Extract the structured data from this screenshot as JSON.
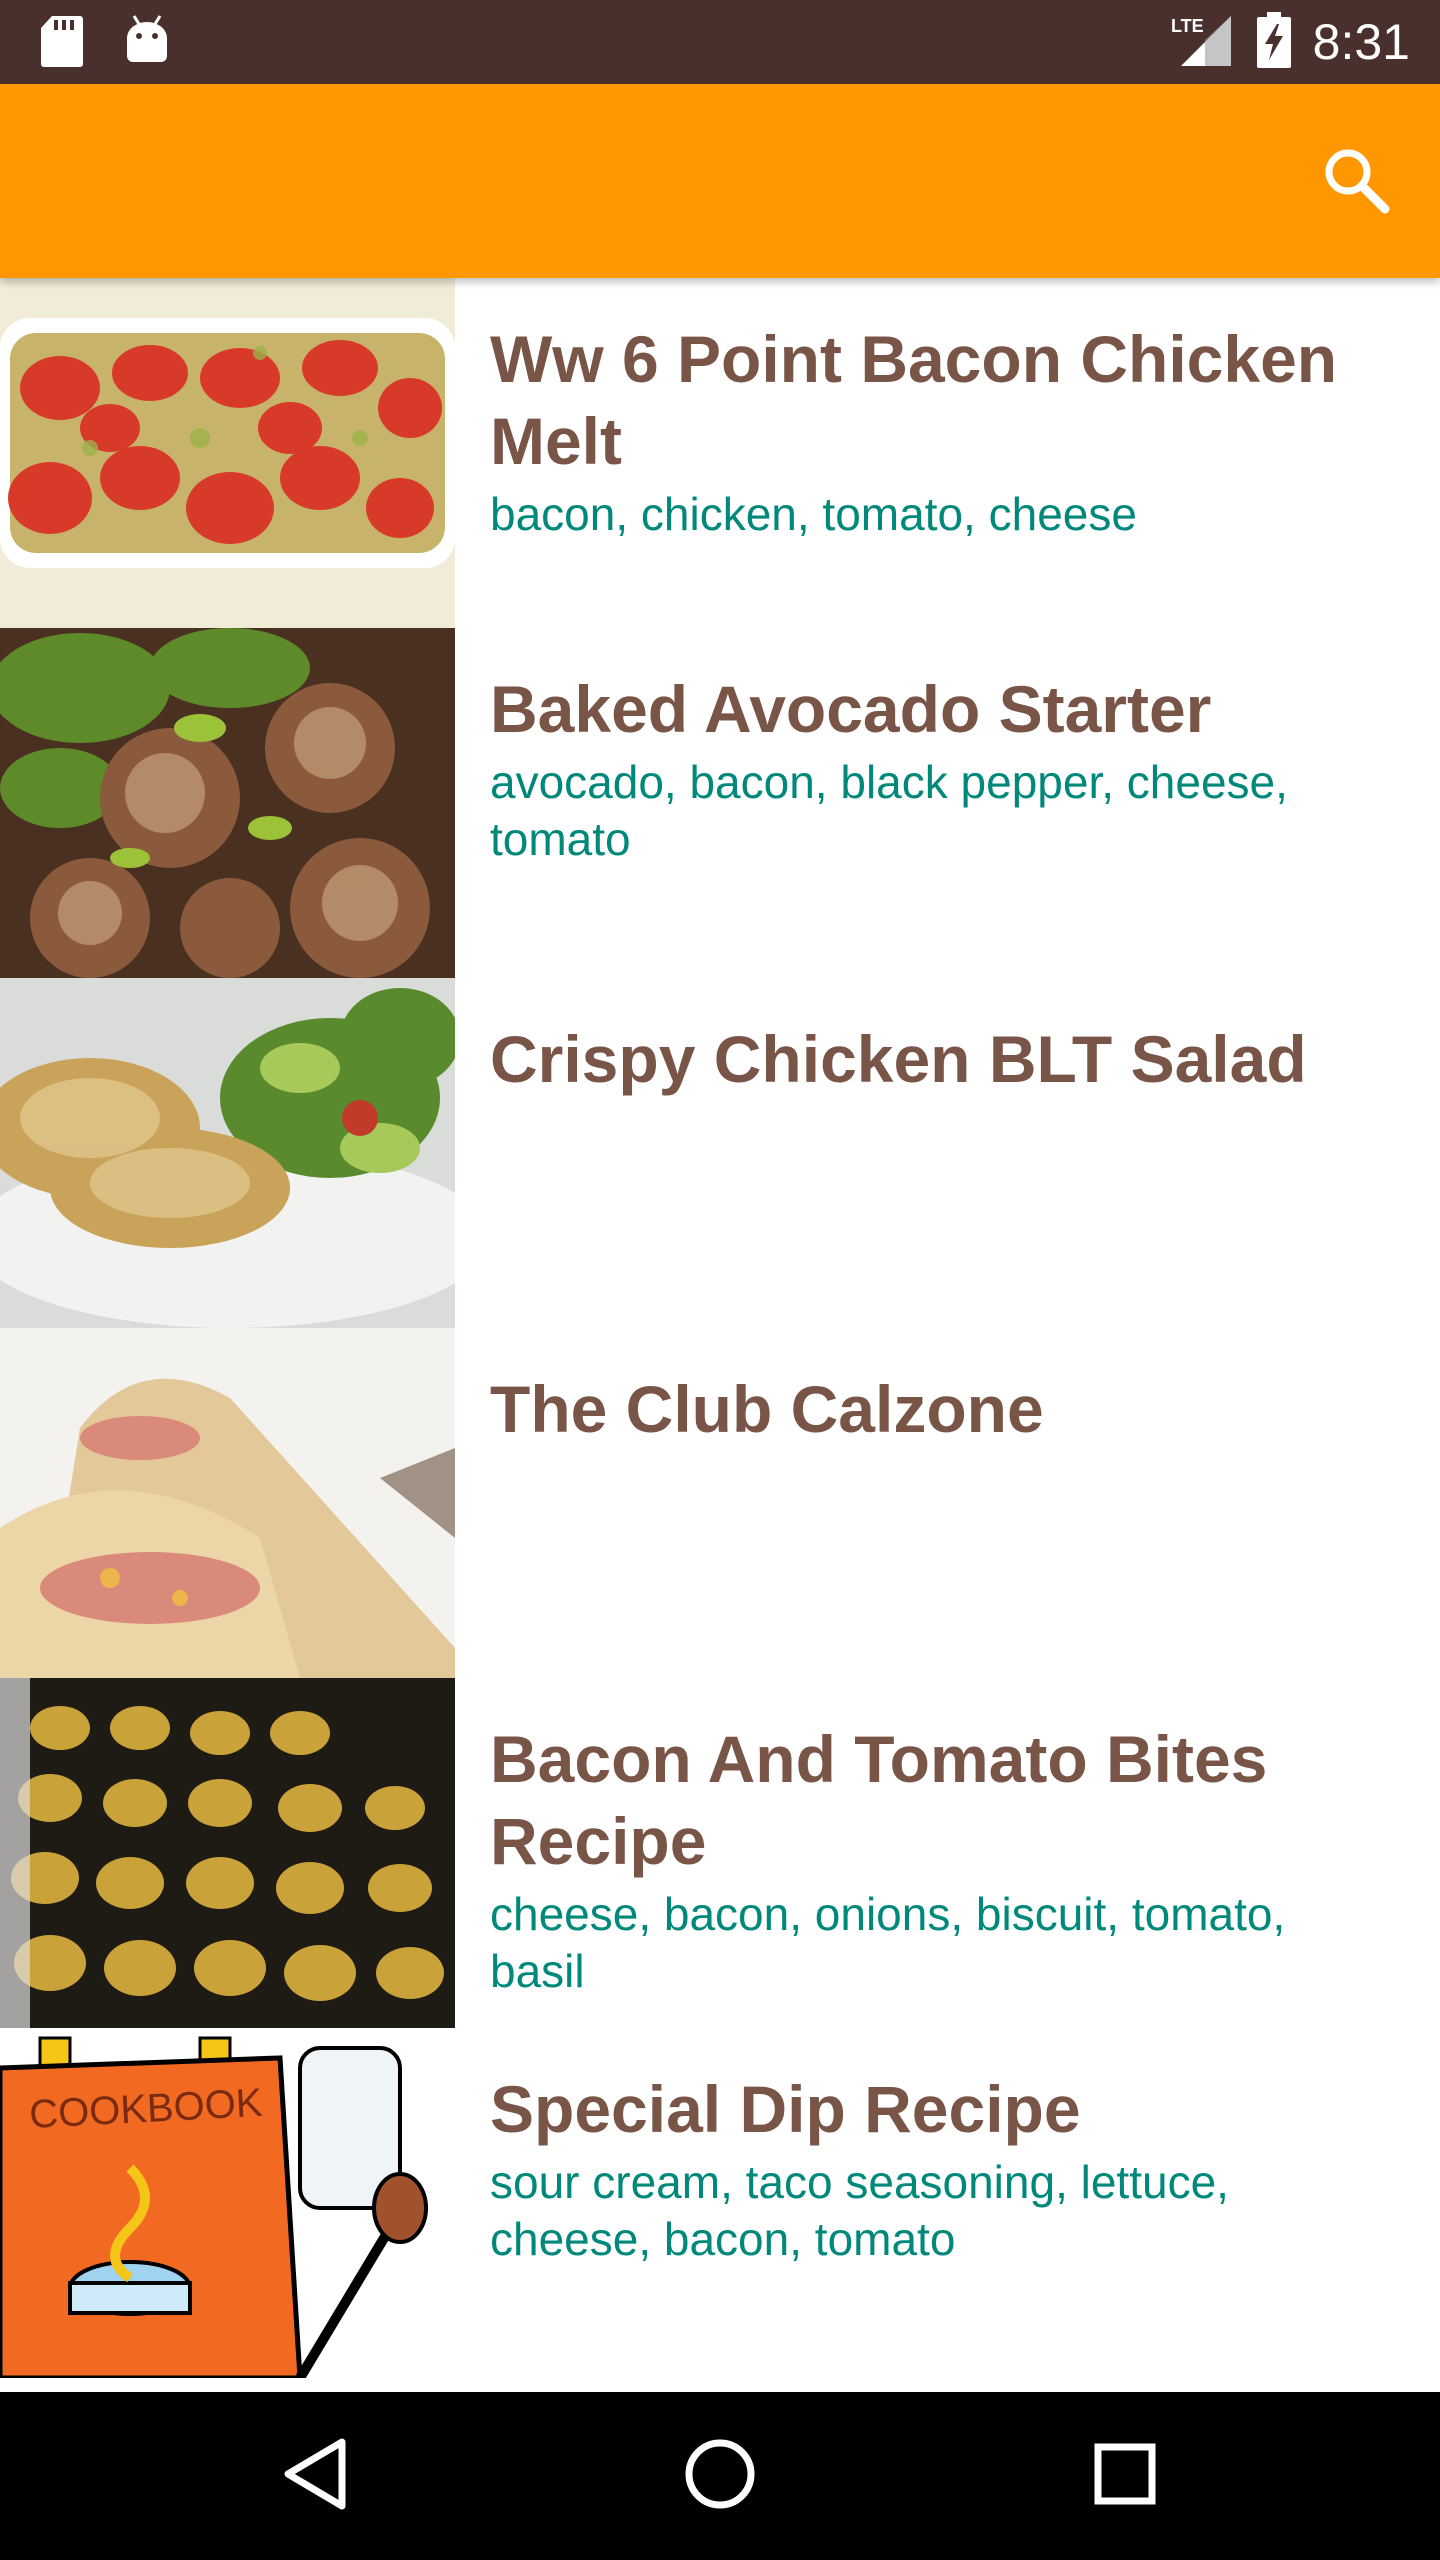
{
  "status_bar": {
    "time": "8:31",
    "network": "LTE",
    "icons": [
      "sd-card-icon",
      "android-icon",
      "lte-signal-icon",
      "battery-charging-icon"
    ]
  },
  "app_bar": {
    "color": "#ff9800",
    "search_icon": "search-icon"
  },
  "recipes": [
    {
      "title": "Ww 6 Point Bacon Chicken Melt",
      "ingredients": "bacon, chicken, tomato, cheese"
    },
    {
      "title": "Baked Avocado Starter",
      "ingredients": "avocado, bacon, black pepper, cheese, tomato"
    },
    {
      "title": "Crispy Chicken BLT Salad",
      "ingredients": ""
    },
    {
      "title": "The Club Calzone",
      "ingredients": ""
    },
    {
      "title": "Bacon And Tomato Bites Recipe",
      "ingredients": "cheese, bacon, onions, biscuit, tomato, basil"
    },
    {
      "title": "Special Dip Recipe",
      "ingredients": "sour cream, taco seasoning, lettuce, cheese, bacon, tomato"
    }
  ],
  "colors": {
    "title": "#795548",
    "ingredients": "#00897b",
    "status_bar": "#4a302c"
  },
  "nav_bar": [
    "back-icon",
    "home-icon",
    "recents-icon"
  ]
}
